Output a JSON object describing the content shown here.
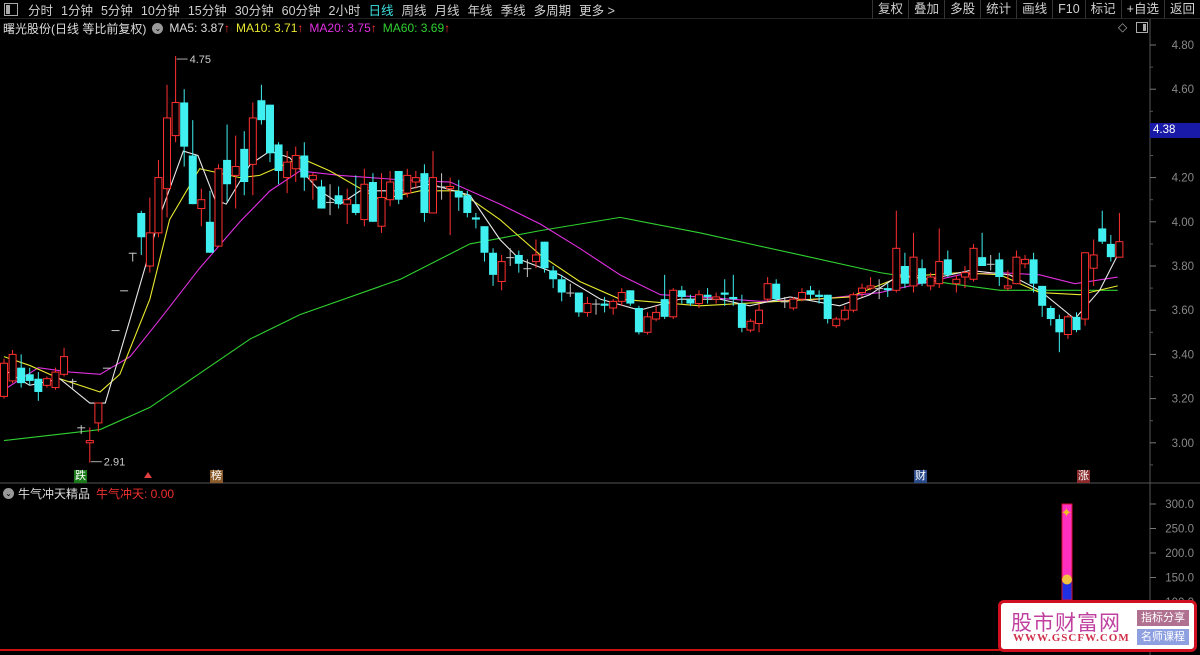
{
  "topbar": {
    "periods": [
      "分时",
      "1分钟",
      "5分钟",
      "10分钟",
      "15分钟",
      "30分钟",
      "60分钟",
      "2小时",
      "日线",
      "周线",
      "月线",
      "年线",
      "季线",
      "多周期",
      "更多 >"
    ],
    "active": "日线",
    "tools": [
      "复权",
      "叠加",
      "多股",
      "统计",
      "画线",
      "F10",
      "标记",
      "+自选",
      "返回"
    ]
  },
  "legend": {
    "title": "曙光股份(日线 等比前复权)",
    "ma5": "MA5: 3.87",
    "ma10": "MA10: 3.71",
    "ma20": "MA20: 3.75",
    "ma60": "MA60: 3.69",
    "arrow": "↑"
  },
  "colors": {
    "up": "#ff3030",
    "down": "#40f0f0",
    "ma5": "#e8e8e8",
    "ma10": "#e8e830",
    "ma20": "#e030e0",
    "ma60": "#30d030",
    "doji": "#c8c8c8"
  },
  "annotations": {
    "high": "4.75",
    "low": "2.91"
  },
  "markers": {
    "die": "跌",
    "bang": "榜",
    "cai": "财",
    "zhang": "涨"
  },
  "price_tag": "4.38",
  "sub": {
    "title": "牛气冲天精品",
    "label": "牛气冲天: 0.00",
    "bar_top": 300,
    "bar_split": 150
  },
  "watermark": {
    "title": "股市财富网",
    "url": "WWW.GSCFW.COM",
    "tag1": "指标分享",
    "tag2": "名师课程"
  },
  "chart_data": {
    "type": "candlestick",
    "ylim": [
      2.85,
      4.9
    ],
    "yticks": [
      "4.80",
      "4.60",
      "4.40",
      "4.20",
      "4.00",
      "3.80",
      "3.60",
      "3.40",
      "3.20",
      "3.00"
    ],
    "sub_yticks": [
      "300.0",
      "250.0",
      "200.0",
      "150.0",
      "100.0"
    ],
    "candles": [
      [
        3.21,
        3.36,
        3.38,
        3.2
      ],
      [
        3.28,
        3.4,
        3.42,
        3.27
      ],
      [
        3.34,
        3.27,
        3.4,
        3.25
      ],
      [
        3.31,
        3.28,
        3.34,
        3.26
      ],
      [
        3.29,
        3.23,
        3.32,
        3.19
      ],
      [
        3.26,
        3.29,
        3.3,
        3.25
      ],
      [
        3.25,
        3.32,
        3.34,
        3.24
      ],
      [
        3.31,
        3.39,
        3.43,
        3.3
      ],
      [
        3.28,
        3.28,
        3.29,
        3.24
      ],
      [
        3.07,
        3.07,
        3.08,
        3.04
      ],
      [
        3.0,
        3.01,
        3.07,
        2.91
      ],
      [
        3.09,
        3.18,
        3.18,
        3.05
      ],
      [
        3.34,
        3.34,
        3.34,
        3.34
      ],
      [
        3.51,
        3.51,
        3.51,
        3.51
      ],
      [
        3.69,
        3.69,
        3.69,
        3.69
      ],
      [
        3.86,
        3.86,
        3.86,
        3.82
      ],
      [
        4.04,
        3.93,
        4.05,
        3.85
      ],
      [
        3.8,
        3.95,
        4.11,
        3.77
      ],
      [
        3.95,
        4.2,
        4.28,
        3.93
      ],
      [
        4.15,
        4.47,
        4.62,
        4.02
      ],
      [
        4.39,
        4.54,
        4.75,
        4.36
      ],
      [
        4.54,
        4.34,
        4.6,
        4.25
      ],
      [
        4.3,
        4.08,
        4.46,
        4.08
      ],
      [
        4.06,
        4.1,
        4.15,
        3.98
      ],
      [
        4.0,
        3.86,
        4.14,
        3.86
      ],
      [
        3.89,
        4.24,
        4.26,
        3.89
      ],
      [
        4.28,
        4.17,
        4.44,
        4.09
      ],
      [
        4.21,
        4.25,
        4.39,
        4.06
      ],
      [
        4.33,
        4.18,
        4.41,
        4.12
      ],
      [
        4.26,
        4.47,
        4.54,
        4.12
      ],
      [
        4.55,
        4.46,
        4.62,
        4.44
      ],
      [
        4.53,
        4.31,
        4.53,
        4.27
      ],
      [
        4.35,
        4.23,
        4.36,
        4.17
      ],
      [
        4.2,
        4.27,
        4.32,
        4.13
      ],
      [
        4.24,
        4.3,
        4.34,
        4.18
      ],
      [
        4.3,
        4.2,
        4.36,
        4.14
      ],
      [
        4.19,
        4.21,
        4.22,
        4.1
      ],
      [
        4.16,
        4.06,
        4.19,
        4.06
      ],
      [
        4.09,
        4.09,
        4.17,
        4.03
      ],
      [
        4.12,
        4.08,
        4.16,
        4.06
      ],
      [
        4.08,
        4.1,
        4.15,
        3.99
      ],
      [
        4.08,
        4.04,
        4.21,
        4.03
      ],
      [
        4.01,
        4.17,
        4.24,
        3.98
      ],
      [
        4.18,
        4.0,
        4.22,
        4.0
      ],
      [
        3.98,
        4.11,
        4.22,
        3.95
      ],
      [
        4.1,
        4.18,
        4.23,
        4.07
      ],
      [
        4.23,
        4.1,
        4.23,
        4.08
      ],
      [
        4.13,
        4.21,
        4.24,
        4.11
      ],
      [
        4.18,
        4.2,
        4.23,
        4.15
      ],
      [
        4.22,
        4.04,
        4.26,
        4.0
      ],
      [
        4.04,
        4.2,
        4.32,
        4.04
      ],
      [
        4.16,
        4.16,
        4.22,
        4.1
      ],
      [
        4.15,
        4.16,
        4.2,
        3.94
      ],
      [
        4.14,
        4.11,
        4.19,
        4.05
      ],
      [
        4.12,
        4.04,
        4.14,
        4.02
      ],
      [
        4.02,
        4.01,
        4.04,
        3.97
      ],
      [
        3.98,
        3.86,
        3.98,
        3.82
      ],
      [
        3.86,
        3.76,
        3.88,
        3.71
      ],
      [
        3.73,
        3.82,
        3.85,
        3.69
      ],
      [
        3.84,
        3.84,
        3.88,
        3.8
      ],
      [
        3.85,
        3.81,
        3.87,
        3.77
      ],
      [
        3.79,
        3.79,
        3.83,
        3.75
      ],
      [
        3.82,
        3.85,
        3.92,
        3.79
      ],
      [
        3.91,
        3.79,
        3.91,
        3.77
      ],
      [
        3.78,
        3.74,
        3.8,
        3.7
      ],
      [
        3.74,
        3.68,
        3.76,
        3.64
      ],
      [
        3.68,
        3.68,
        3.72,
        3.66
      ],
      [
        3.68,
        3.59,
        3.68,
        3.57
      ],
      [
        3.59,
        3.63,
        3.66,
        3.57
      ],
      [
        3.63,
        3.63,
        3.65,
        3.58
      ],
      [
        3.63,
        3.62,
        3.66,
        3.59
      ],
      [
        3.61,
        3.64,
        3.65,
        3.58
      ],
      [
        3.64,
        3.68,
        3.7,
        3.62
      ],
      [
        3.69,
        3.63,
        3.69,
        3.62
      ],
      [
        3.61,
        3.5,
        3.62,
        3.49
      ],
      [
        3.5,
        3.57,
        3.59,
        3.49
      ],
      [
        3.56,
        3.59,
        3.62,
        3.55
      ],
      [
        3.65,
        3.57,
        3.76,
        3.56
      ],
      [
        3.57,
        3.69,
        3.7,
        3.56
      ],
      [
        3.69,
        3.66,
        3.71,
        3.63
      ],
      [
        3.65,
        3.63,
        3.67,
        3.62
      ],
      [
        3.63,
        3.67,
        3.69,
        3.61
      ],
      [
        3.67,
        3.66,
        3.7,
        3.63
      ],
      [
        3.65,
        3.66,
        3.68,
        3.63
      ],
      [
        3.68,
        3.67,
        3.74,
        3.62
      ],
      [
        3.66,
        3.65,
        3.76,
        3.62
      ],
      [
        3.63,
        3.52,
        3.67,
        3.5
      ],
      [
        3.51,
        3.55,
        3.56,
        3.5
      ],
      [
        3.54,
        3.6,
        3.63,
        3.5
      ],
      [
        3.65,
        3.72,
        3.75,
        3.64
      ],
      [
        3.72,
        3.65,
        3.74,
        3.64
      ],
      [
        3.64,
        3.64,
        3.66,
        3.61
      ],
      [
        3.61,
        3.65,
        3.66,
        3.6
      ],
      [
        3.65,
        3.68,
        3.7,
        3.64
      ],
      [
        3.69,
        3.67,
        3.71,
        3.65
      ],
      [
        3.67,
        3.66,
        3.69,
        3.63
      ],
      [
        3.67,
        3.56,
        3.67,
        3.54
      ],
      [
        3.53,
        3.56,
        3.57,
        3.52
      ],
      [
        3.56,
        3.6,
        3.62,
        3.55
      ],
      [
        3.6,
        3.67,
        3.68,
        3.59
      ],
      [
        3.68,
        3.7,
        3.72,
        3.66
      ],
      [
        3.7,
        3.71,
        3.75,
        3.69
      ],
      [
        3.7,
        3.7,
        3.74,
        3.65
      ],
      [
        3.7,
        3.69,
        3.72,
        3.66
      ],
      [
        3.69,
        3.88,
        4.05,
        3.68
      ],
      [
        3.8,
        3.72,
        3.86,
        3.7
      ],
      [
        3.71,
        3.84,
        3.95,
        3.68
      ],
      [
        3.79,
        3.72,
        3.83,
        3.71
      ],
      [
        3.71,
        3.75,
        3.77,
        3.69
      ],
      [
        3.72,
        3.82,
        3.97,
        3.7
      ],
      [
        3.83,
        3.76,
        3.87,
        3.75
      ],
      [
        3.72,
        3.74,
        3.76,
        3.68
      ],
      [
        3.75,
        3.77,
        3.8,
        3.7
      ],
      [
        3.74,
        3.88,
        3.9,
        3.73
      ],
      [
        3.84,
        3.8,
        3.95,
        3.8
      ],
      [
        3.81,
        3.81,
        3.85,
        3.78
      ],
      [
        3.83,
        3.75,
        3.86,
        3.71
      ],
      [
        3.7,
        3.71,
        3.78,
        3.69
      ],
      [
        3.72,
        3.84,
        3.87,
        3.72
      ],
      [
        3.81,
        3.83,
        3.85,
        3.79
      ],
      [
        3.83,
        3.72,
        3.86,
        3.68
      ],
      [
        3.71,
        3.62,
        3.71,
        3.57
      ],
      [
        3.61,
        3.56,
        3.62,
        3.53
      ],
      [
        3.56,
        3.5,
        3.58,
        3.41
      ],
      [
        3.49,
        3.57,
        3.58,
        3.47
      ],
      [
        3.57,
        3.51,
        3.59,
        3.5
      ],
      [
        3.56,
        3.86,
        3.86,
        3.53
      ],
      [
        3.79,
        3.85,
        3.92,
        3.71
      ],
      [
        3.97,
        3.91,
        4.05,
        3.9
      ],
      [
        3.9,
        3.84,
        3.94,
        3.82
      ],
      [
        3.84,
        3.91,
        4.04,
        3.84
      ]
    ],
    "ma": {
      "ma5": [
        [
          0,
          3.33
        ],
        [
          3,
          3.26
        ],
        [
          6.5,
          3.29
        ],
        [
          10,
          3.18
        ],
        [
          11.8,
          3.18
        ],
        [
          14.7,
          3.56
        ],
        [
          18.2,
          4.03
        ],
        [
          20.9,
          4.32
        ],
        [
          22.6,
          4.3
        ],
        [
          24.6,
          4.1
        ],
        [
          25.9,
          4.08
        ],
        [
          28.7,
          4.26
        ],
        [
          31,
          4.32
        ],
        [
          33.3,
          4.29
        ],
        [
          36.8,
          4.14
        ],
        [
          39.2,
          4.08
        ],
        [
          41.5,
          4.14
        ],
        [
          46.2,
          4.14
        ],
        [
          49.7,
          4.17
        ],
        [
          54.3,
          4.12
        ],
        [
          57.8,
          3.92
        ],
        [
          60.1,
          3.83
        ],
        [
          64.8,
          3.76
        ],
        [
          69.5,
          3.65
        ],
        [
          74.1,
          3.6
        ],
        [
          78.8,
          3.65
        ],
        [
          83.4,
          3.65
        ],
        [
          86.9,
          3.62
        ],
        [
          91.6,
          3.66
        ],
        [
          97.4,
          3.62
        ],
        [
          100.9,
          3.67
        ],
        [
          104.4,
          3.76
        ],
        [
          107.9,
          3.74
        ],
        [
          112.6,
          3.78
        ],
        [
          117.2,
          3.76
        ],
        [
          120.7,
          3.69
        ],
        [
          124.8,
          3.56
        ],
        [
          127.7,
          3.69
        ],
        [
          129.8,
          3.85
        ]
      ],
      "ma10": [
        [
          0,
          3.39
        ],
        [
          3,
          3.35
        ],
        [
          6.5,
          3.29
        ],
        [
          11.2,
          3.23
        ],
        [
          13.5,
          3.31
        ],
        [
          17,
          3.65
        ],
        [
          19.3,
          4.01
        ],
        [
          22.8,
          4.24
        ],
        [
          27.5,
          4.2
        ],
        [
          29.8,
          4.21
        ],
        [
          34.5,
          4.29
        ],
        [
          38,
          4.23
        ],
        [
          43.8,
          4.1
        ],
        [
          48.5,
          4.14
        ],
        [
          53,
          4.14
        ],
        [
          57.8,
          4.01
        ],
        [
          62.5,
          3.85
        ],
        [
          67.1,
          3.73
        ],
        [
          71.8,
          3.65
        ],
        [
          81.1,
          3.62
        ],
        [
          90.4,
          3.64
        ],
        [
          98.6,
          3.66
        ],
        [
          104.4,
          3.75
        ],
        [
          111.4,
          3.77
        ],
        [
          116.1,
          3.76
        ],
        [
          120.7,
          3.68
        ],
        [
          125.4,
          3.67
        ],
        [
          129.8,
          3.71
        ]
      ],
      "ma20": [
        [
          0,
          3.24
        ],
        [
          4,
          3.34
        ],
        [
          7.7,
          3.32
        ],
        [
          11.2,
          3.31
        ],
        [
          14.7,
          3.39
        ],
        [
          18.2,
          3.56
        ],
        [
          22.8,
          3.79
        ],
        [
          27.5,
          4.0
        ],
        [
          31,
          4.14
        ],
        [
          34.5,
          4.23
        ],
        [
          39.2,
          4.21
        ],
        [
          46.2,
          4.19
        ],
        [
          52,
          4.18
        ],
        [
          57.8,
          4.08
        ],
        [
          62.5,
          3.99
        ],
        [
          67.1,
          3.88
        ],
        [
          71.8,
          3.76
        ],
        [
          76.5,
          3.67
        ],
        [
          81.1,
          3.66
        ],
        [
          88.1,
          3.64
        ],
        [
          95.1,
          3.65
        ],
        [
          102.1,
          3.68
        ],
        [
          111.4,
          3.76
        ],
        [
          116.1,
          3.77
        ],
        [
          120.7,
          3.76
        ],
        [
          124.8,
          3.72
        ],
        [
          129.8,
          3.75
        ]
      ],
      "ma60": [
        [
          0,
          3.01
        ],
        [
          11.2,
          3.06
        ],
        [
          17,
          3.16
        ],
        [
          28.7,
          3.47
        ],
        [
          34.5,
          3.58
        ],
        [
          46.2,
          3.74
        ],
        [
          54.3,
          3.9
        ],
        [
          62.5,
          3.96
        ],
        [
          71.8,
          4.02
        ],
        [
          81.1,
          3.95
        ],
        [
          92.8,
          3.85
        ],
        [
          102.1,
          3.77
        ],
        [
          110.3,
          3.72
        ],
        [
          116.1,
          3.69
        ],
        [
          121.9,
          3.69
        ],
        [
          129.8,
          3.69
        ]
      ]
    }
  }
}
